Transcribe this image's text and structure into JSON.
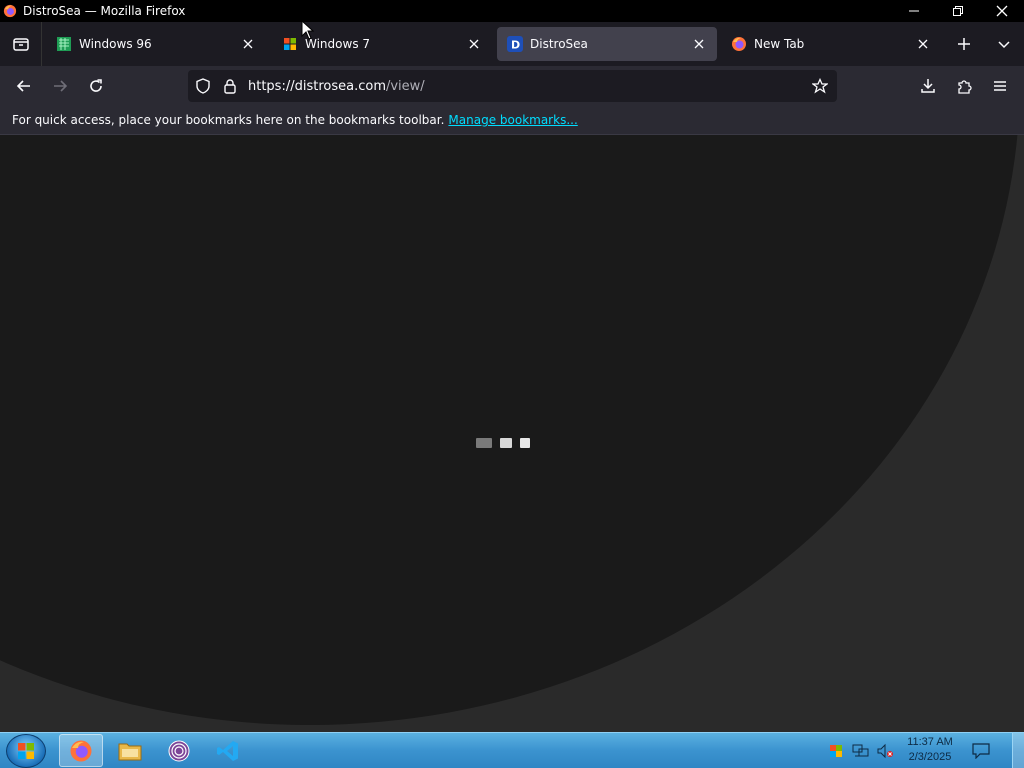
{
  "window": {
    "title": "DistroSea — Mozilla Firefox"
  },
  "tabs": [
    {
      "label": "Windows 96",
      "icon": "windows96-icon",
      "active": false
    },
    {
      "label": "Windows 7",
      "icon": "windows-flag-icon",
      "active": false
    },
    {
      "label": "DistroSea",
      "icon": "distrosea-d-icon",
      "active": true
    },
    {
      "label": "New Tab",
      "icon": "firefox-icon",
      "active": false
    }
  ],
  "urlbar": {
    "host": "https://distrosea.com",
    "path": "/view/"
  },
  "bookmarks": {
    "message": "For quick access, place your bookmarks here on the bookmarks toolbar.",
    "link": "Manage bookmarks..."
  },
  "taskbar": {
    "apps": [
      "firefox-icon",
      "file-explorer-icon",
      "tor-browser-icon",
      "vscode-icon"
    ],
    "clock_time": "11:37 AM",
    "clock_date": "2/3/2025"
  },
  "colors": {
    "accent_link": "#00ddff",
    "active_tab": "#42414d",
    "taskbar": "#3b93cf",
    "loader_dot_1": "#7a7a7a",
    "loader_dot_2": "#d8d8d8",
    "loader_dot_3": "#e8e8e8"
  }
}
